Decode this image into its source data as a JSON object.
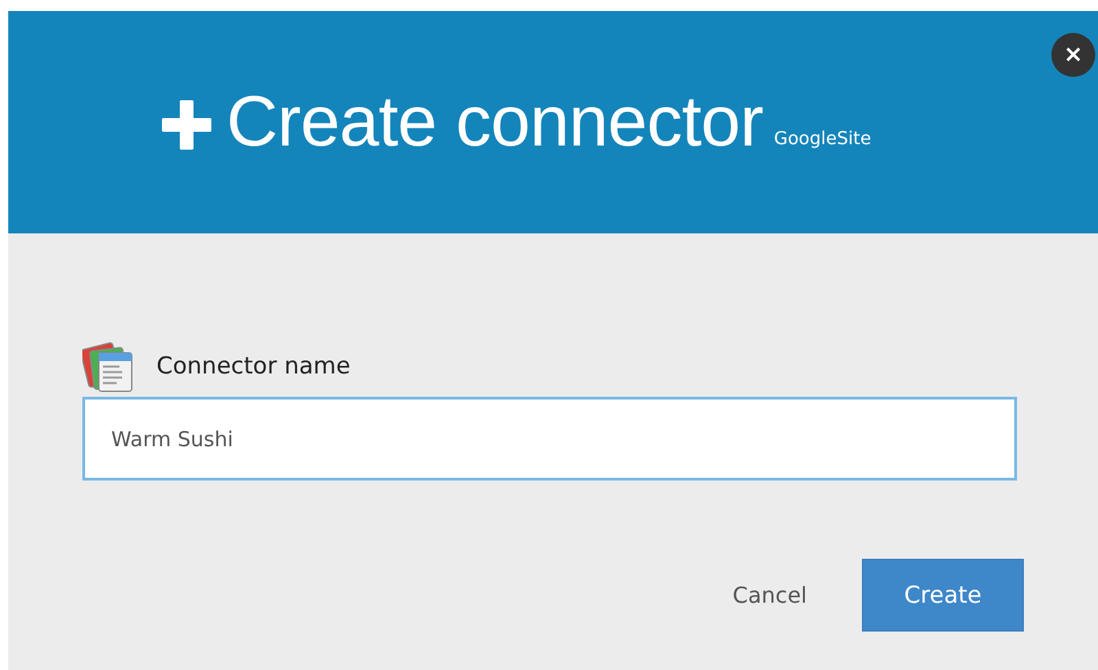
{
  "dialog": {
    "title": "Create connector",
    "subtitle": "GoogleSite",
    "close_label": "×"
  },
  "field": {
    "label": "Connector name",
    "value": "Warm Sushi",
    "focused": true
  },
  "buttons": [
    {
      "label": "Cancel",
      "kind": "link"
    },
    {
      "label": "Create",
      "kind": "primary"
    }
  ]
}
